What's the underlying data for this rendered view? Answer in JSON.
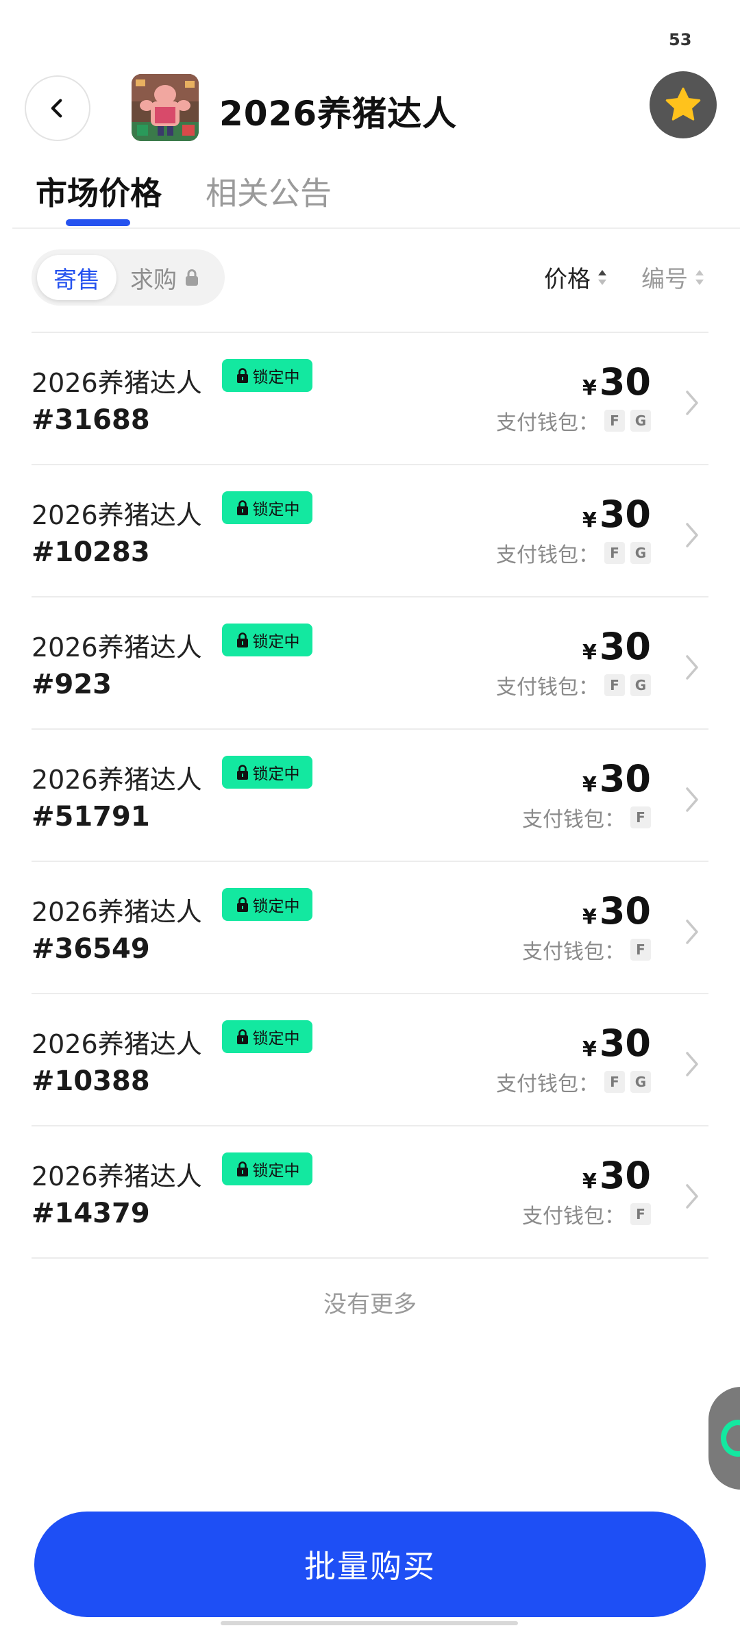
{
  "status_bar": {
    "count": "53"
  },
  "header": {
    "title": "2026养猪达人",
    "back_icon": "chevron-left-icon",
    "favorite_icon": "star-icon",
    "favorite_color": "#ffc21c"
  },
  "tabs": [
    {
      "label": "市场价格",
      "active": true
    },
    {
      "label": "相关公告",
      "active": false
    }
  ],
  "segment": {
    "sell_label": "寄售",
    "buy_label": "求购",
    "buy_icon": "lock-icon"
  },
  "sort": {
    "price_label": "价格",
    "number_label": "编号"
  },
  "list": {
    "items": [
      {
        "name": "2026养猪达人",
        "tag": "锁定中",
        "id": "#31688",
        "currency": "¥",
        "price": "30",
        "wallet_label": "支付钱包：",
        "wallets": [
          "F",
          "G"
        ]
      },
      {
        "name": "2026养猪达人",
        "tag": "锁定中",
        "id": "#10283",
        "currency": "¥",
        "price": "30",
        "wallet_label": "支付钱包：",
        "wallets": [
          "F",
          "G"
        ]
      },
      {
        "name": "2026养猪达人",
        "tag": "锁定中",
        "id": "#923",
        "currency": "¥",
        "price": "30",
        "wallet_label": "支付钱包：",
        "wallets": [
          "F",
          "G"
        ]
      },
      {
        "name": "2026养猪达人",
        "tag": "锁定中",
        "id": "#51791",
        "currency": "¥",
        "price": "30",
        "wallet_label": "支付钱包：",
        "wallets": [
          "F"
        ]
      },
      {
        "name": "2026养猪达人",
        "tag": "锁定中",
        "id": "#36549",
        "currency": "¥",
        "price": "30",
        "wallet_label": "支付钱包：",
        "wallets": [
          "F"
        ]
      },
      {
        "name": "2026养猪达人",
        "tag": "锁定中",
        "id": "#10388",
        "currency": "¥",
        "price": "30",
        "wallet_label": "支付钱包：",
        "wallets": [
          "F",
          "G"
        ]
      },
      {
        "name": "2026养猪达人",
        "tag": "锁定中",
        "id": "#14379",
        "currency": "¥",
        "price": "30",
        "wallet_label": "支付钱包：",
        "wallets": [
          "F"
        ]
      }
    ],
    "end_text": "没有更多"
  },
  "footer": {
    "batch_buy_label": "批量购买"
  },
  "colors": {
    "accent": "#1e4ff5",
    "tag_green": "#13e8a0"
  }
}
